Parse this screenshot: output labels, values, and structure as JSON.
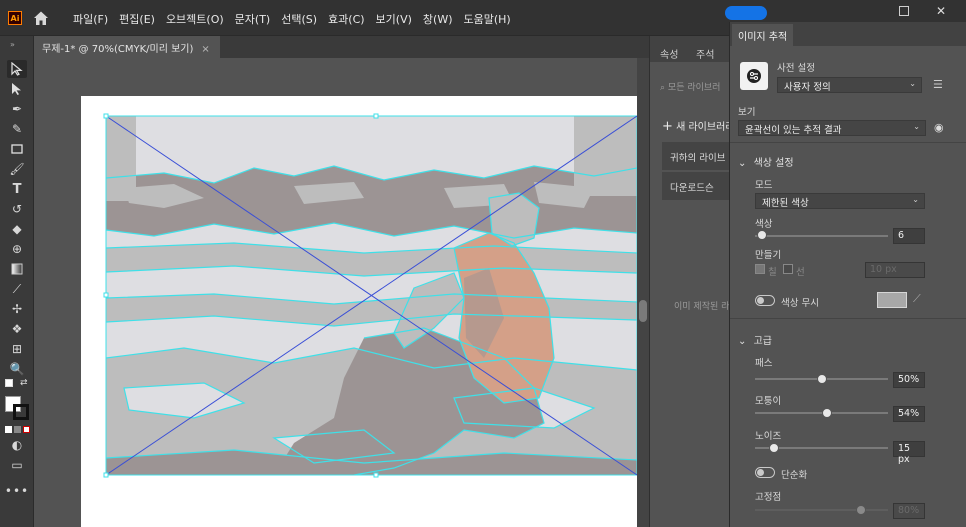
{
  "app": {
    "logo": "Ai"
  },
  "menu": [
    "파일(F)",
    "편집(E)",
    "오브젝트(O)",
    "문자(T)",
    "선택(S)",
    "효과(C)",
    "보기(V)",
    "창(W)",
    "도움말(H)"
  ],
  "document_tab": {
    "title": "무제-1* @ 70%(CMYK/미리 보기)",
    "close": "×"
  },
  "libraries_panel": {
    "tabs": [
      "속성",
      "주석"
    ],
    "search_placeholder": "모든 라이브러",
    "new_library": "새 라이브러리",
    "items": [
      "귀하의 라이브",
      "다운로드슨"
    ],
    "empty_text": "이미 제작된 라이"
  },
  "trace_panel": {
    "tab": "이미지 추적",
    "preset_label": "사전 설정",
    "preset_value": "사용자 정의",
    "view_label": "보기",
    "view_value": "윤곽선이 있는 추적 결과",
    "color_settings_label": "색상 설정",
    "mode_label": "모드",
    "mode_value": "제한된 색상",
    "colors_label": "색상",
    "colors_value": "6",
    "colors_fraction": 0.05,
    "create_label": "만들기",
    "fill_label": "칠",
    "stroke_label": "선",
    "stroke_value": "10 px",
    "ignore_color_label": "색상 무시",
    "advanced_label": "고급",
    "paths_label": "패스",
    "paths_value": "50%",
    "paths_fraction": 0.5,
    "corners_label": "모퉁이",
    "corners_value": "54%",
    "corners_fraction": 0.54,
    "noise_label": "노이즈",
    "noise_value": "15 px",
    "noise_fraction": 0.14,
    "simplify_label": "단순화",
    "snap_label": "고정점",
    "snap_value": "80%",
    "snap_fraction": 0.8
  },
  "colors": {
    "selection": "#3fe0e8",
    "cross": "#3a4fd6",
    "skin": "#d4a088",
    "dark": "#9c9494",
    "mid": "#bdbdbd",
    "light": "#dedee2"
  }
}
